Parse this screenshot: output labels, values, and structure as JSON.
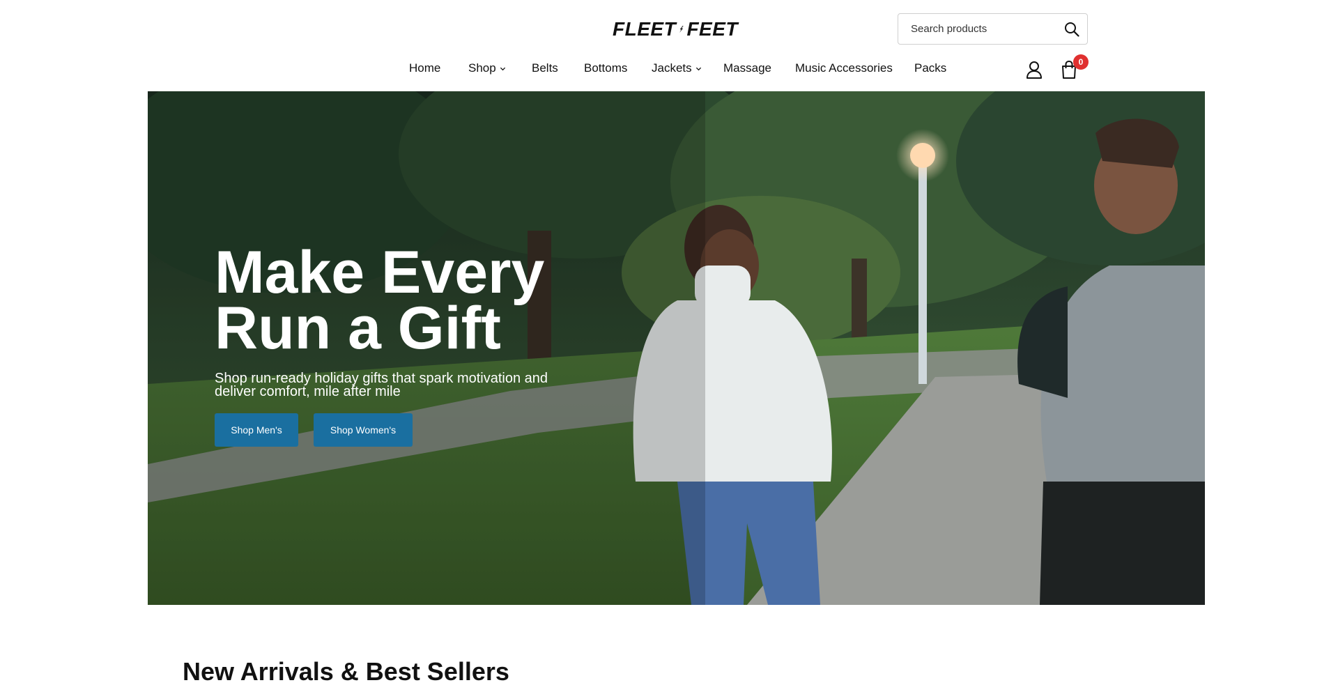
{
  "header": {
    "logo_text_left": "FLEET",
    "logo_text_right": "FEET",
    "search": {
      "placeholder": "Search products",
      "value": ""
    },
    "nav": [
      {
        "label": "Home",
        "has_dropdown": false
      },
      {
        "label": "Shop",
        "has_dropdown": true
      },
      {
        "label": "Belts",
        "has_dropdown": false
      },
      {
        "label": "Bottoms",
        "has_dropdown": false
      },
      {
        "label": "Jackets",
        "has_dropdown": true
      },
      {
        "label": "Massage",
        "has_dropdown": false
      },
      {
        "label": "Music Accessories",
        "has_dropdown": false
      },
      {
        "label": "Packs",
        "has_dropdown": false
      }
    ],
    "cart_count": "0",
    "icons": {
      "search": "search-icon",
      "account": "user-icon",
      "cart": "shopping-bag-icon",
      "dropdown": "chevron-down-icon"
    }
  },
  "hero": {
    "title_line1": "Make Every",
    "title_line2": "Run a Gift",
    "subtitle": "Shop run-ready holiday gifts that spark motivation and deliver comfort, mile after mile",
    "buttons": {
      "men": "Shop Men's",
      "women": "Shop Women's"
    }
  },
  "sections": {
    "new_arrivals_title": "New Arrivals & Best Sellers"
  },
  "colors": {
    "accent_button": "#1a6fa0",
    "badge": "#e0302f",
    "text": "#111111"
  }
}
